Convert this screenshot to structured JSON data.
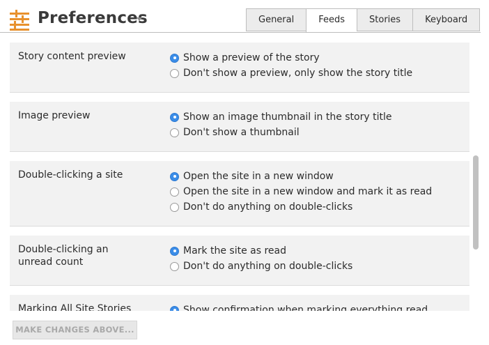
{
  "header": {
    "title": "Preferences",
    "tabs": [
      {
        "label": "General",
        "active": false
      },
      {
        "label": "Feeds",
        "active": true
      },
      {
        "label": "Stories",
        "active": false
      },
      {
        "label": "Keyboard",
        "active": false
      }
    ]
  },
  "sections": [
    {
      "label": "Story content preview",
      "options": [
        {
          "label": "Show a preview of the story",
          "checked": true
        },
        {
          "label": "Don't show a preview, only show the story title",
          "checked": false
        }
      ]
    },
    {
      "label": "Image preview",
      "options": [
        {
          "label": "Show an image thumbnail in the story title",
          "checked": true
        },
        {
          "label": "Don't show a thumbnail",
          "checked": false
        }
      ]
    },
    {
      "label": "Double-clicking a site",
      "options": [
        {
          "label": "Open the site in a new window",
          "checked": true
        },
        {
          "label": "Open the site in a new window and mark it as read",
          "checked": false
        },
        {
          "label": "Don't do anything on double-clicks",
          "checked": false
        }
      ]
    },
    {
      "label_lines": [
        "Double-clicking an",
        "unread count"
      ],
      "options": [
        {
          "label": "Mark the site as read",
          "checked": true
        },
        {
          "label": "Don't do anything on double-clicks",
          "checked": false
        }
      ]
    },
    {
      "label": "Marking All Site Stories",
      "options": [
        {
          "label": "Show confirmation when marking everything read",
          "checked": true
        }
      ]
    }
  ],
  "footer": {
    "save_label": "MAKE CHANGES ABOVE..."
  },
  "colors": {
    "accent": "#3b8de8",
    "logo": "#e8912d",
    "section_bg": "#f2f2f2"
  },
  "icons": {
    "logo": "newsblur-logo-icon",
    "title_menu": "chevron-down-icon"
  }
}
